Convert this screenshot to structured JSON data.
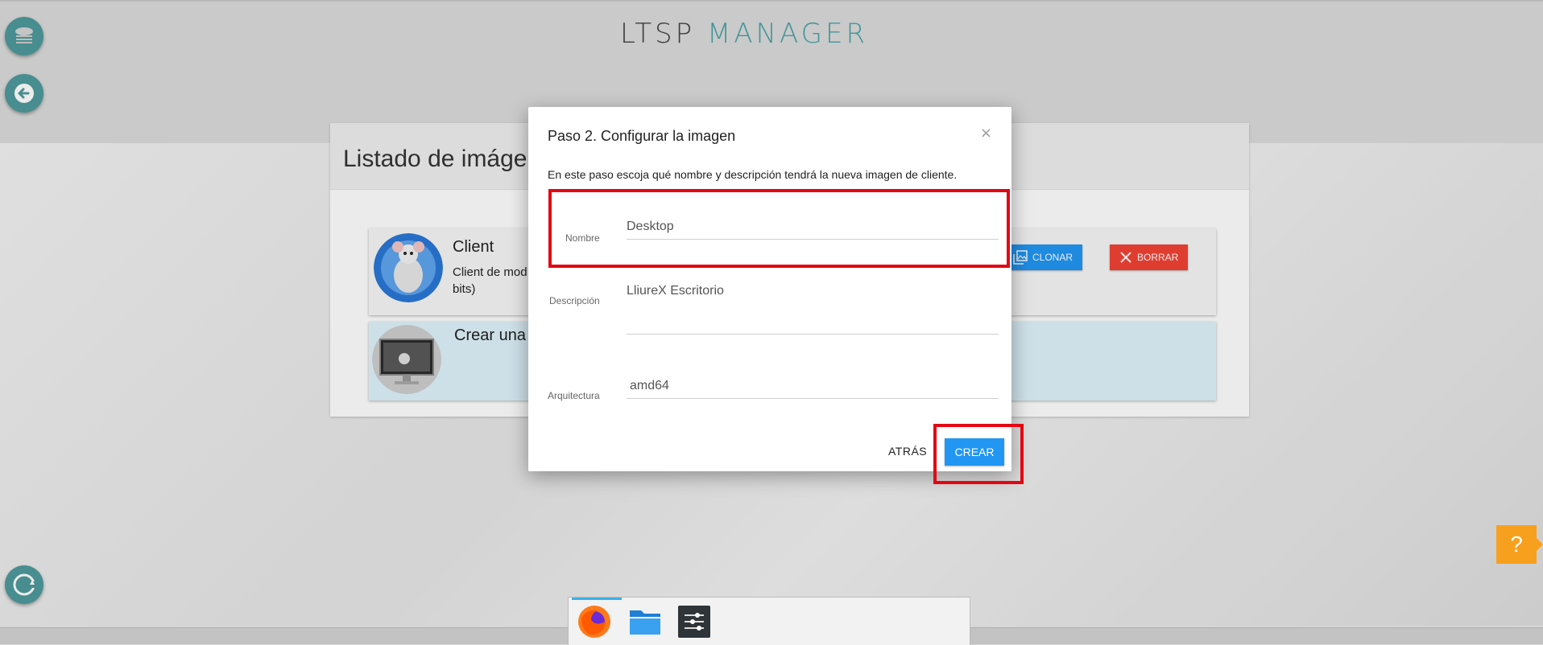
{
  "logo": {
    "part1": "LTSP",
    "part2": "MANAGER"
  },
  "sidebar": {
    "buttons": [
      {
        "name": "server-icon"
      },
      {
        "name": "back-arrow-icon"
      },
      {
        "name": "refresh-icon"
      }
    ]
  },
  "panel": {
    "title": "Listado de imágenes",
    "cards": [
      {
        "name": "Client",
        "description_line1": "Client de mod",
        "description_line2": "bits)",
        "clone_label": "CLONAR",
        "delete_label": "BORRAR"
      },
      {
        "name": "Crear una"
      }
    ]
  },
  "modal": {
    "title": "Paso 2. Configurar la imagen",
    "close": "×",
    "description": "En este paso escoja qué nombre y descripción tendrá la nueva imagen de cliente.",
    "fields": {
      "name": {
        "label": "Nombre",
        "value": "Desktop"
      },
      "description": {
        "label": "Descripción",
        "value": "LliureX Escritorio"
      },
      "architecture": {
        "label": "Arquitectura",
        "value": "amd64"
      }
    },
    "back_label": "ATRÁS",
    "create_label": "CREAR"
  },
  "help": {
    "label": "?"
  },
  "taskbar": {
    "items": [
      {
        "name": "firefox-icon"
      },
      {
        "name": "folder-icon"
      },
      {
        "name": "settings-sliders-icon"
      }
    ]
  },
  "colors": {
    "accent_teal": "#4f9a9c",
    "primary_blue": "#2196f3",
    "danger_red": "#f44336",
    "highlight_red": "#e30613",
    "help_orange": "#f7a01e"
  }
}
